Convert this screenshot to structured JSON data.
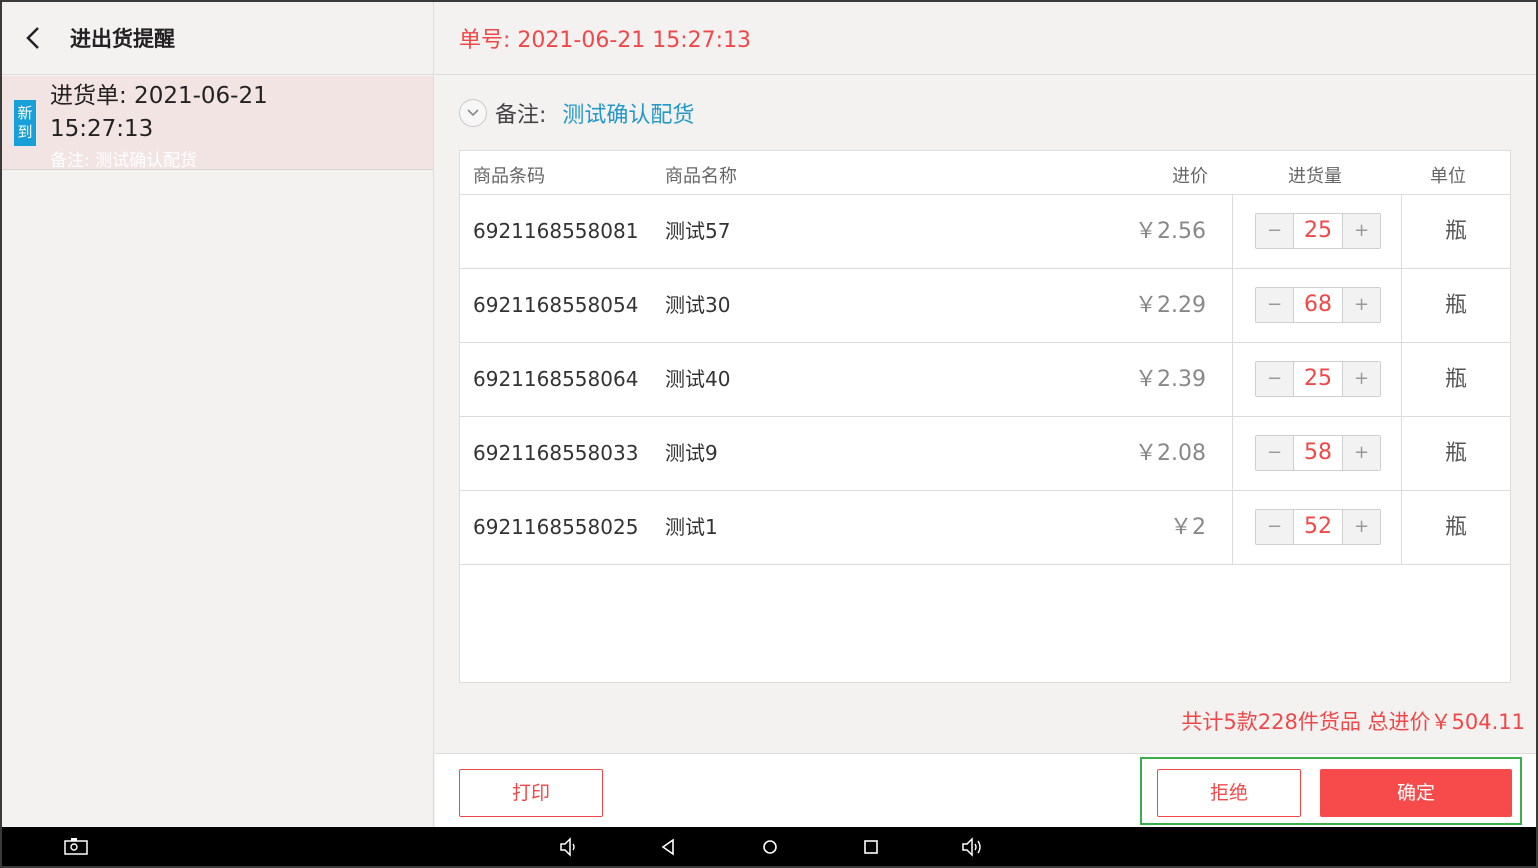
{
  "left": {
    "title": "进出货提醒",
    "order": {
      "badge": "新到",
      "title": "进货单: 2021-06-21 15:27:13",
      "note": "备注: 测试确认配货"
    }
  },
  "right": {
    "order_no": "单号: 2021-06-21 15:27:13",
    "remark_label": "备注:",
    "remark_value": "测试确认配货",
    "table": {
      "headers": {
        "code": "商品条码",
        "name": "商品名称",
        "price": "进价",
        "qty": "进货量",
        "unit": "单位"
      },
      "rows": [
        {
          "code": "6921168558081",
          "name": "测试57",
          "price": "￥2.56",
          "qty": "25",
          "unit": "瓶"
        },
        {
          "code": "6921168558054",
          "name": "测试30",
          "price": "￥2.29",
          "qty": "68",
          "unit": "瓶"
        },
        {
          "code": "6921168558064",
          "name": "测试40",
          "price": "￥2.39",
          "qty": "25",
          "unit": "瓶"
        },
        {
          "code": "6921168558033",
          "name": "测试9",
          "price": "￥2.08",
          "qty": "58",
          "unit": "瓶"
        },
        {
          "code": "6921168558025",
          "name": "测试1",
          "price": "￥2",
          "qty": "52",
          "unit": "瓶"
        }
      ],
      "minus_symbol": "−",
      "plus_symbol": "+"
    },
    "summary": "共计5款228件货品 总进价￥504.11",
    "buttons": {
      "print": "打印",
      "reject": "拒绝",
      "confirm": "确定"
    }
  },
  "colors": {
    "accent_red": "#f04848",
    "confirm_bg": "#f74b4b",
    "badge_blue": "#1aa0d8",
    "remark_blue": "#2399c9",
    "highlight_green": "#3bad4b"
  },
  "navbar": {
    "icons": [
      "screenshot-icon",
      "volume-down-icon",
      "back-triangle-icon",
      "home-circle-icon",
      "recents-square-icon",
      "volume-up-icon"
    ]
  }
}
